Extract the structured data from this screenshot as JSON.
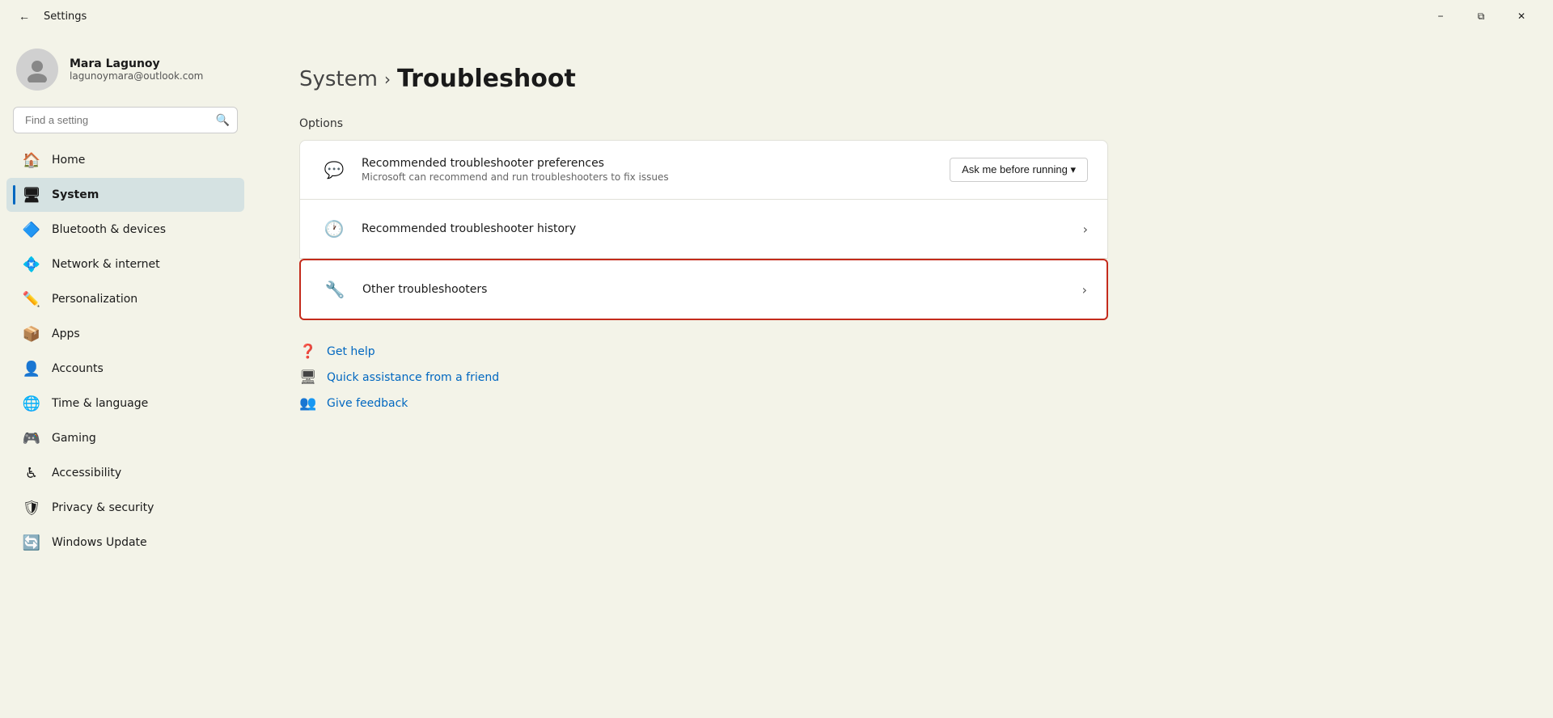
{
  "titleBar": {
    "title": "Settings",
    "minimizeLabel": "−",
    "restoreLabel": "⧉",
    "closeLabel": "✕"
  },
  "sidebar": {
    "user": {
      "name": "Mara Lagunoy",
      "email": "lagunoymara@outlook.com"
    },
    "search": {
      "placeholder": "Find a setting"
    },
    "nav": [
      {
        "id": "home",
        "label": "Home",
        "icon": "🏠",
        "active": false
      },
      {
        "id": "system",
        "label": "System",
        "icon": "🖥",
        "active": true
      },
      {
        "id": "bluetooth",
        "label": "Bluetooth & devices",
        "icon": "🔷",
        "active": false
      },
      {
        "id": "network",
        "label": "Network & internet",
        "icon": "💠",
        "active": false
      },
      {
        "id": "personalization",
        "label": "Personalization",
        "icon": "✏️",
        "active": false
      },
      {
        "id": "apps",
        "label": "Apps",
        "icon": "📦",
        "active": false
      },
      {
        "id": "accounts",
        "label": "Accounts",
        "icon": "👤",
        "active": false
      },
      {
        "id": "time",
        "label": "Time & language",
        "icon": "🌐",
        "active": false
      },
      {
        "id": "gaming",
        "label": "Gaming",
        "icon": "🎮",
        "active": false
      },
      {
        "id": "accessibility",
        "label": "Accessibility",
        "icon": "♿",
        "active": false
      },
      {
        "id": "privacy",
        "label": "Privacy & security",
        "icon": "🛡",
        "active": false
      },
      {
        "id": "update",
        "label": "Windows Update",
        "icon": "🔄",
        "active": false
      }
    ]
  },
  "main": {
    "breadcrumb": {
      "parent": "System",
      "separator": "›",
      "current": "Troubleshoot"
    },
    "optionsLabel": "Options",
    "settings": [
      {
        "id": "recommended-prefs",
        "icon": "💬",
        "title": "Recommended troubleshooter preferences",
        "desc": "Microsoft can recommend and run troubleshooters to fix issues",
        "dropdown": "Ask me before running",
        "chevron": false,
        "highlighted": false
      },
      {
        "id": "recommended-history",
        "icon": "🕐",
        "title": "Recommended troubleshooter history",
        "desc": "",
        "dropdown": null,
        "chevron": true,
        "highlighted": false
      },
      {
        "id": "other-troubleshooters",
        "icon": "🔧",
        "title": "Other troubleshooters",
        "desc": "",
        "dropdown": null,
        "chevron": true,
        "highlighted": true
      }
    ],
    "links": [
      {
        "id": "get-help",
        "icon": "❓",
        "label": "Get help"
      },
      {
        "id": "quick-assistance",
        "icon": "🖥",
        "label": "Quick assistance from a friend"
      },
      {
        "id": "give-feedback",
        "icon": "👥",
        "label": "Give feedback"
      }
    ]
  }
}
